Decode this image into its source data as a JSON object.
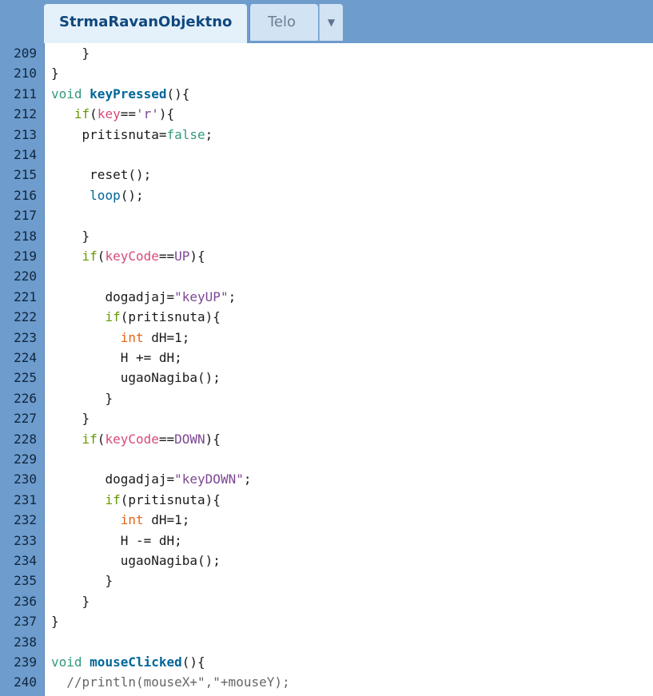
{
  "tabs": [
    {
      "label": "StrmaRavanObjektno",
      "active": true
    },
    {
      "label": "Telo",
      "active": false
    }
  ],
  "tab_dropdown_icon": "triangle-down",
  "colors": {
    "tabbar_bg": "#6d9ccd",
    "gutter_bg": "#6d9ccd",
    "active_tab_bg": "#e4f1fb",
    "active_tab_text": "#10487d",
    "plain": "#1a1a1a",
    "kw": "#33997e",
    "control": "#669900",
    "func": "#006699",
    "builtin_var": "#d94a7a",
    "const": "#7d4793",
    "string": "#7d4793",
    "type": "#e2661a",
    "comment": "#666666"
  },
  "code_lines": [
    {
      "num": "209",
      "indent": "    ",
      "tokens": [
        {
          "t": "}",
          "c": "plain"
        }
      ]
    },
    {
      "num": "210",
      "indent": "",
      "tokens": [
        {
          "t": "}",
          "c": "plain"
        }
      ]
    },
    {
      "num": "211",
      "indent": "",
      "tokens": [
        {
          "t": "void",
          "c": "kw"
        },
        {
          "t": " ",
          "c": "plain"
        },
        {
          "t": "keyPressed",
          "c": "func_bold"
        },
        {
          "t": "(){",
          "c": "plain"
        }
      ]
    },
    {
      "num": "212",
      "indent": "   ",
      "tokens": [
        {
          "t": "if",
          "c": "control"
        },
        {
          "t": "(",
          "c": "plain"
        },
        {
          "t": "key",
          "c": "builtin_var"
        },
        {
          "t": "==",
          "c": "plain"
        },
        {
          "t": "'r'",
          "c": "string"
        },
        {
          "t": "){",
          "c": "plain"
        }
      ]
    },
    {
      "num": "213",
      "indent": "    ",
      "tokens": [
        {
          "t": "pritisnuta=",
          "c": "plain"
        },
        {
          "t": "false",
          "c": "kw"
        },
        {
          "t": ";",
          "c": "plain"
        }
      ]
    },
    {
      "num": "214",
      "indent": "",
      "tokens": []
    },
    {
      "num": "215",
      "indent": "     ",
      "tokens": [
        {
          "t": "reset();",
          "c": "plain"
        }
      ]
    },
    {
      "num": "216",
      "indent": "     ",
      "tokens": [
        {
          "t": "loop",
          "c": "func"
        },
        {
          "t": "();",
          "c": "plain"
        }
      ]
    },
    {
      "num": "217",
      "indent": "",
      "tokens": []
    },
    {
      "num": "218",
      "indent": "    ",
      "tokens": [
        {
          "t": "}",
          "c": "plain"
        }
      ]
    },
    {
      "num": "219",
      "indent": "    ",
      "tokens": [
        {
          "t": "if",
          "c": "control"
        },
        {
          "t": "(",
          "c": "plain"
        },
        {
          "t": "keyCode",
          "c": "builtin_var"
        },
        {
          "t": "==",
          "c": "plain"
        },
        {
          "t": "UP",
          "c": "const"
        },
        {
          "t": "){",
          "c": "plain"
        }
      ]
    },
    {
      "num": "220",
      "indent": "",
      "tokens": []
    },
    {
      "num": "221",
      "indent": "       ",
      "tokens": [
        {
          "t": "dogadjaj=",
          "c": "plain"
        },
        {
          "t": "\"keyUP\"",
          "c": "string"
        },
        {
          "t": ";",
          "c": "plain"
        }
      ]
    },
    {
      "num": "222",
      "indent": "       ",
      "tokens": [
        {
          "t": "if",
          "c": "control"
        },
        {
          "t": "(pritisnuta){",
          "c": "plain"
        }
      ]
    },
    {
      "num": "223",
      "indent": "         ",
      "tokens": [
        {
          "t": "int",
          "c": "type"
        },
        {
          "t": " dH=1;",
          "c": "plain"
        }
      ]
    },
    {
      "num": "224",
      "indent": "         ",
      "tokens": [
        {
          "t": "H += dH;",
          "c": "plain"
        }
      ]
    },
    {
      "num": "225",
      "indent": "         ",
      "tokens": [
        {
          "t": "ugaoNagiba();",
          "c": "plain"
        }
      ]
    },
    {
      "num": "226",
      "indent": "       ",
      "tokens": [
        {
          "t": "}",
          "c": "plain"
        }
      ]
    },
    {
      "num": "227",
      "indent": "    ",
      "tokens": [
        {
          "t": "}",
          "c": "plain"
        }
      ]
    },
    {
      "num": "228",
      "indent": "    ",
      "tokens": [
        {
          "t": "if",
          "c": "control"
        },
        {
          "t": "(",
          "c": "plain"
        },
        {
          "t": "keyCode",
          "c": "builtin_var"
        },
        {
          "t": "==",
          "c": "plain"
        },
        {
          "t": "DOWN",
          "c": "const"
        },
        {
          "t": "){",
          "c": "plain"
        }
      ]
    },
    {
      "num": "229",
      "indent": "",
      "tokens": []
    },
    {
      "num": "230",
      "indent": "       ",
      "tokens": [
        {
          "t": "dogadjaj=",
          "c": "plain"
        },
        {
          "t": "\"keyDOWN\"",
          "c": "string"
        },
        {
          "t": ";",
          "c": "plain"
        }
      ]
    },
    {
      "num": "231",
      "indent": "       ",
      "tokens": [
        {
          "t": "if",
          "c": "control"
        },
        {
          "t": "(pritisnuta){",
          "c": "plain"
        }
      ]
    },
    {
      "num": "232",
      "indent": "         ",
      "tokens": [
        {
          "t": "int",
          "c": "type"
        },
        {
          "t": " dH=1;",
          "c": "plain"
        }
      ]
    },
    {
      "num": "233",
      "indent": "         ",
      "tokens": [
        {
          "t": "H -= dH;",
          "c": "plain"
        }
      ]
    },
    {
      "num": "234",
      "indent": "         ",
      "tokens": [
        {
          "t": "ugaoNagiba();",
          "c": "plain"
        }
      ]
    },
    {
      "num": "235",
      "indent": "       ",
      "tokens": [
        {
          "t": "}",
          "c": "plain"
        }
      ]
    },
    {
      "num": "236",
      "indent": "    ",
      "tokens": [
        {
          "t": "}",
          "c": "plain"
        }
      ]
    },
    {
      "num": "237",
      "indent": "",
      "tokens": [
        {
          "t": "}",
          "c": "plain"
        }
      ]
    },
    {
      "num": "238",
      "indent": "",
      "tokens": []
    },
    {
      "num": "239",
      "indent": "",
      "tokens": [
        {
          "t": "void",
          "c": "kw"
        },
        {
          "t": " ",
          "c": "plain"
        },
        {
          "t": "mouseClicked",
          "c": "func_bold"
        },
        {
          "t": "(){",
          "c": "plain"
        }
      ]
    },
    {
      "num": "240",
      "indent": "  ",
      "tokens": [
        {
          "t": "//println(mouseX+\",\"+mouseY);",
          "c": "comment"
        }
      ]
    }
  ]
}
